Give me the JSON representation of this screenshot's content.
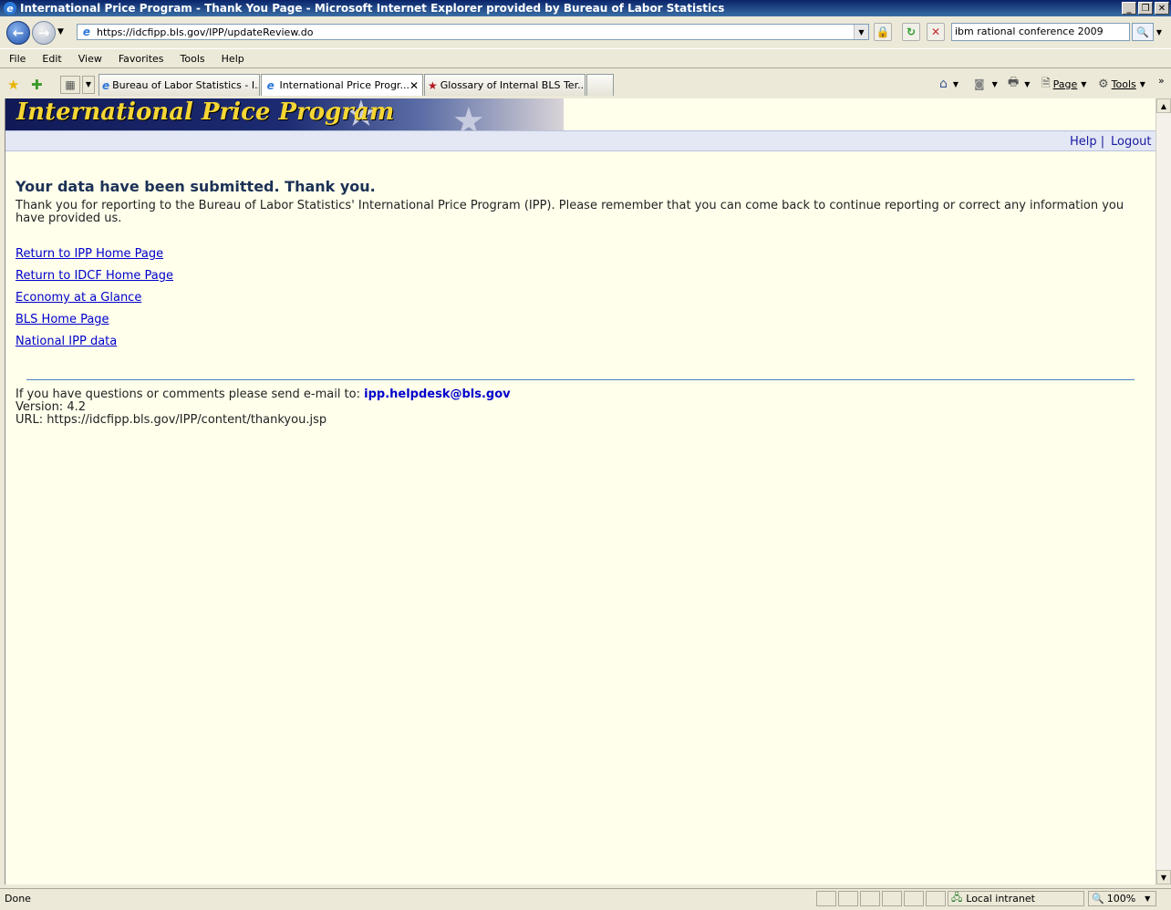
{
  "window": {
    "title": "International Price Program - Thank You Page - Microsoft Internet Explorer provided by Bureau of Labor Statistics",
    "minimize_icon": "minimize-icon",
    "restore_icon": "restore-icon",
    "close_icon": "close-icon"
  },
  "toolbar": {
    "address": "https://idcfipp.bls.gov/IPP/updateReview.do",
    "search_value": "ibm rational conference 2009"
  },
  "menu": [
    "File",
    "Edit",
    "View",
    "Favorites",
    "Tools",
    "Help"
  ],
  "tabs": [
    {
      "label": "Bureau of Labor Statistics - I...",
      "active": false
    },
    {
      "label": "International Price Progr...",
      "active": true
    },
    {
      "label": "Glossary of Internal BLS Ter...",
      "active": false
    }
  ],
  "commandbar": {
    "page_label": "Page",
    "tools_label": "Tools"
  },
  "page": {
    "banner_title": "International Price Program",
    "help_link": "Help |",
    "logout_link": "Logout",
    "heading": "Your data have been submitted. Thank you.",
    "message": "Thank you for reporting to the Bureau of Labor Statistics' International Price Program (IPP). Please remember that you can come back to continue reporting or correct any information you have provided us.",
    "links": [
      "Return to IPP Home Page",
      "Return to IDCF Home Page",
      "Economy at a Glance",
      "BLS Home Page",
      "National IPP data"
    ],
    "footer_prefix": "If you have questions or comments please send e-mail to:",
    "footer_email": "ipp.helpdesk@bls.gov",
    "version": "Version: 4.2",
    "url": "URL: https://idcfipp.bls.gov/IPP/content/thankyou.jsp"
  },
  "status": {
    "text": "Done",
    "zone": "Local intranet",
    "zoom": "100%"
  },
  "colors": {
    "page_background": "#ffffec",
    "banner_text": "#f5d634",
    "link": "#0000cc",
    "heading": "#1c3156"
  }
}
